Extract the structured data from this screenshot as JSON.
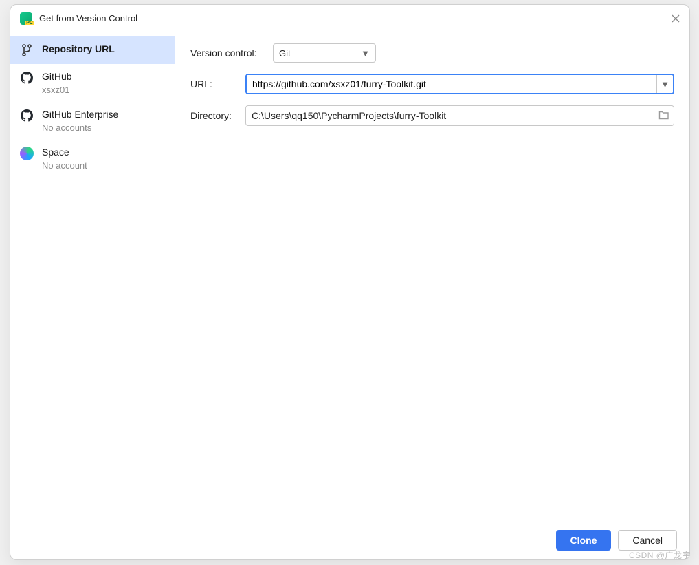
{
  "dialog": {
    "title": "Get from Version Control",
    "watermark": "CSDN @广龙宇"
  },
  "sidebar": {
    "items": [
      {
        "title": "Repository URL",
        "sub": ""
      },
      {
        "title": "GitHub",
        "sub": "xsxz01"
      },
      {
        "title": "GitHub Enterprise",
        "sub": "No accounts"
      },
      {
        "title": "Space",
        "sub": "No account"
      }
    ]
  },
  "form": {
    "vcs_label": "Version control:",
    "vcs_value": "Git",
    "url_label": "URL:",
    "url_value": "https://github.com/xsxz01/furry-Toolkit.git",
    "dir_label": "Directory:",
    "dir_value": "C:\\Users\\qq150\\PycharmProjects\\furry-Toolkit"
  },
  "footer": {
    "clone": "Clone",
    "cancel": "Cancel"
  }
}
